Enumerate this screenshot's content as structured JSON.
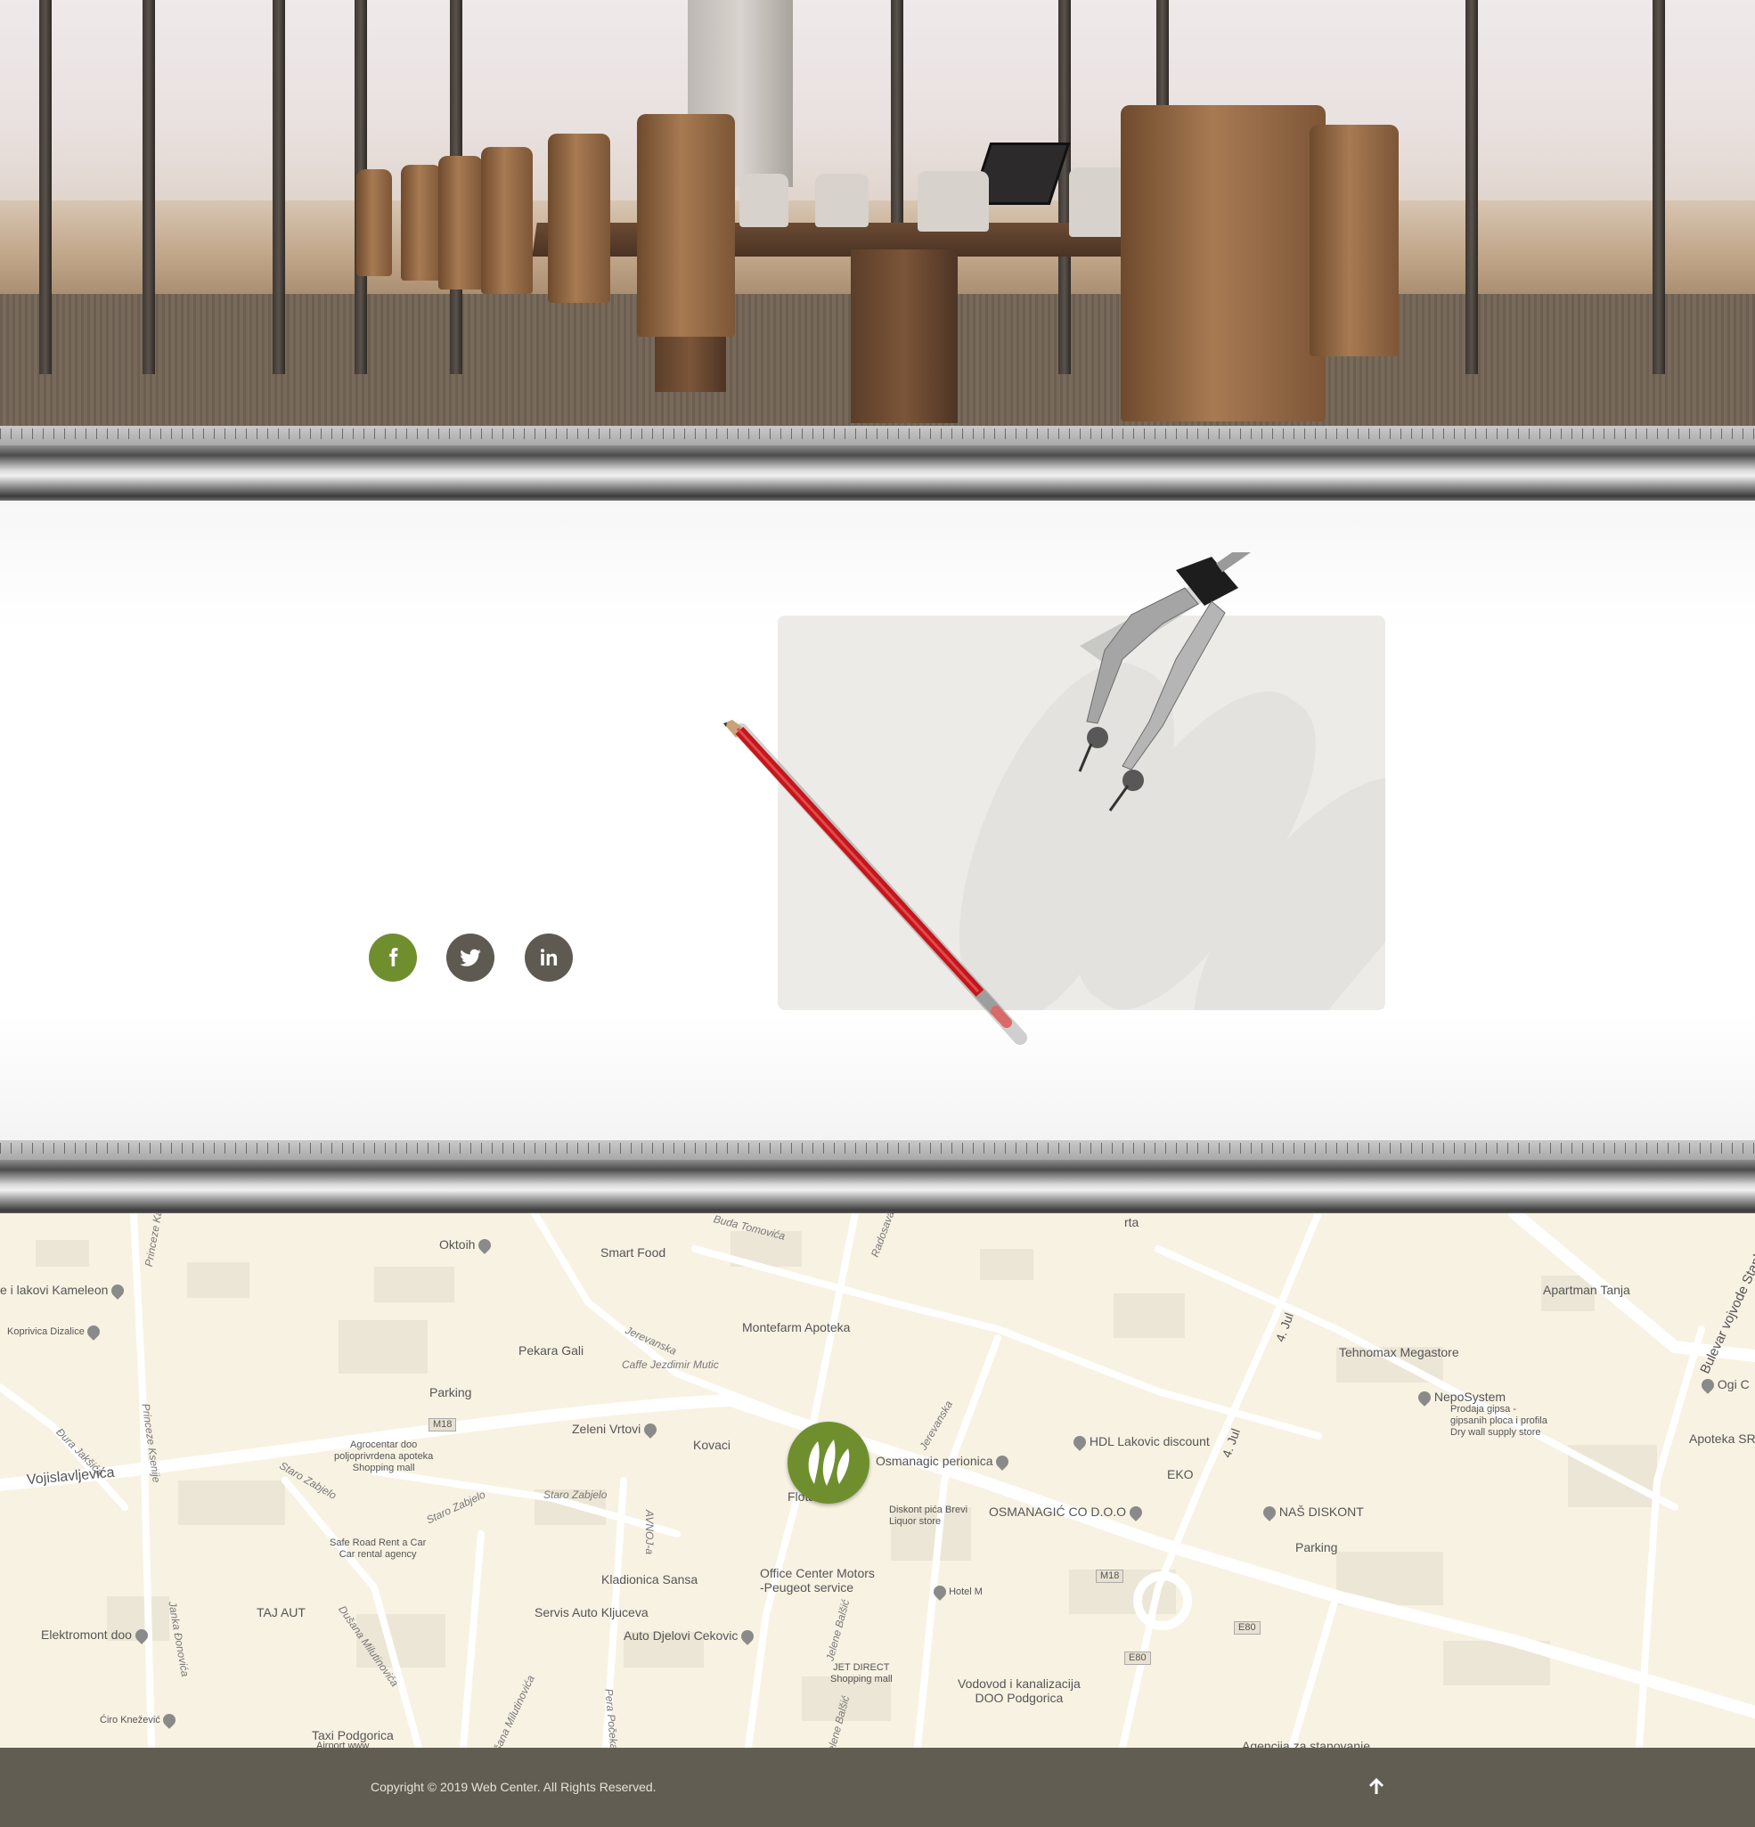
{
  "social": {
    "facebook": "facebook",
    "twitter": "twitter",
    "linkedin": "linkedin"
  },
  "colors": {
    "brand_green": "#6f8f2f",
    "social_gray": "#5f5a51",
    "footer_bg": "#625d53",
    "map_bg": "#f8f2e3"
  },
  "map": {
    "places": {
      "oktoih": "Oktoih",
      "smart_food": "Smart Food",
      "buda_tomovica": "Buda Tomovića",
      "radosava": "Radosava B",
      "lakovi": "e i lakovi Kameleon",
      "koprivica": "Koprivica Dizalice",
      "princeze_ka": "Princeze Ka",
      "pekara": "Pekara Gali",
      "jerevanska": "Jerevanska",
      "caffe": "Caffe Jezdimir Mutic",
      "montefarm": "Montefarm Apoteka",
      "parking1": "Parking",
      "princeze_ksenije": "Princeze Ksenije",
      "dura_jaksica": "Đura Jakšića",
      "m18a": "M18",
      "agrocentar": "Agrocentar doo\npoljoprivrdena apoteka\nShopping mall",
      "zeleni": "Zeleni Vrtovi",
      "kovaci": "Kovaci",
      "vojislavljevica": "Vojislavljevića",
      "staro1": "Staro Zabjelo",
      "staro2": "Staro Zabjelo",
      "staro3": "Staro Zabjelo",
      "flota": "Flota",
      "osmanagic_perionica": "Osmanagic perionica",
      "jerevanska2": "Jerevanska",
      "diskont": "Diskont pića Brevi\nLiquor store",
      "osmanagic_co": "OSMANAGIĆ CO D.O.O",
      "hdl": "HDL Lakovic discount",
      "eko": "EKO",
      "nas_diskont": "NAŠ DISKONT",
      "parking2": "Parking",
      "safe_road": "Safe Road Rent a Car\nCar rental agency",
      "avnoj": "AVNOJ-a",
      "kladionica": "Kladionica Sansa",
      "office_center": "Office Center Motors\n-Peugeot service",
      "hotel_m": "Hotel M",
      "m18b": "M18",
      "e80a": "E80",
      "e80b": "E80",
      "taj_aut": "TAJ AUT",
      "elektromont": "Elektromont doo",
      "janka": "Janka Đonovića",
      "dusana": "Dušana Milutinovića",
      "servis": "Servis Auto Kljuceva",
      "auto_djelovi": "Auto Djelovi Cekovic",
      "jelene1": "Jelene Balšić",
      "jet_direct": "JET DIRECT\nShopping mall",
      "vodovod": "Vodovod i kanalizacija\nDOO Podgorica",
      "ciro": "Ćiro Knežević",
      "taxi": "Taxi Podgorica",
      "airport": "Airport www",
      "dusana2": "Dušana Milutinovića",
      "pera": "Pera Počeka",
      "jelene2": "Jelene Balšić",
      "agencija": "Agencija za stanovanje",
      "apartman": "Apartman Tanja",
      "tehnomax": "Tehnomax Megastore",
      "nepo": "NepoSystem",
      "nepo_desc": "Prodaja gipsa -\ngipsanih ploca i profila\nDry wall supply store",
      "bulevar": "Bulevar vojvode Stanka",
      "ogi": "Ogi C",
      "apoteka_sr": "Apoteka SR",
      "jul1": "4. Jul",
      "jul2": "4. Jul",
      "rta": "rta"
    }
  },
  "footer": {
    "copyright": "Copyright © 2019 Web Center. All Rights Reserved.",
    "back_to_top": "arrow-up-icon"
  }
}
